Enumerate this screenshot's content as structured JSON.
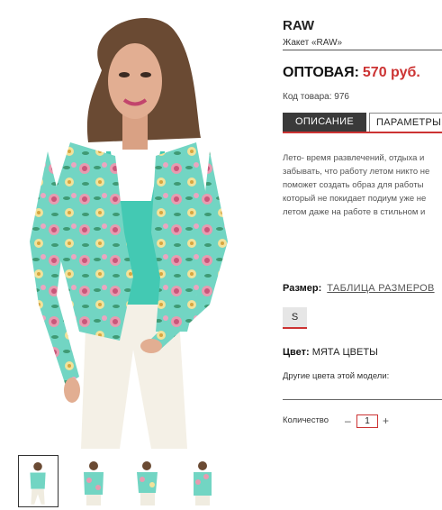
{
  "product": {
    "brand": "RAW",
    "subtitle": "Жакет «RAW»",
    "price_label": "ОПТОВАЯ:",
    "price_value": "570 руб.",
    "sku": "Код товара: 976"
  },
  "tabs": [
    {
      "label": "ОПИСАНИЕ",
      "active": true
    },
    {
      "label": "ПАРАМЕТРЫ",
      "active": false
    }
  ],
  "description": [
    "Лето- время развлечений, отдыха и",
    "забывать, что работу летом никто не",
    "поможет создать образ для работы ",
    "который не покидает подиум уже не",
    "летом даже на работе в стильном и"
  ],
  "size": {
    "label": "Размер:",
    "table_link": "ТАБЛИЦА РАЗМЕРОВ",
    "options": [
      "S"
    ],
    "selected": "S"
  },
  "color": {
    "label": "Цвет:",
    "value": "МЯТА ЦВЕТЫ"
  },
  "other_colors_label": "Другие цвета этой модели:",
  "quantity": {
    "label": "Количество",
    "minus": "–",
    "value": "1",
    "plus": "+"
  },
  "gallery": {
    "main_image": "model-in-floral-blazer",
    "thumbnail_count": 4,
    "active_thumbnail": 1
  },
  "colors": {
    "accent": "#cc3333",
    "tab_active_bg": "#3a3a3a",
    "blazer_mint": "#6fd6c4"
  }
}
